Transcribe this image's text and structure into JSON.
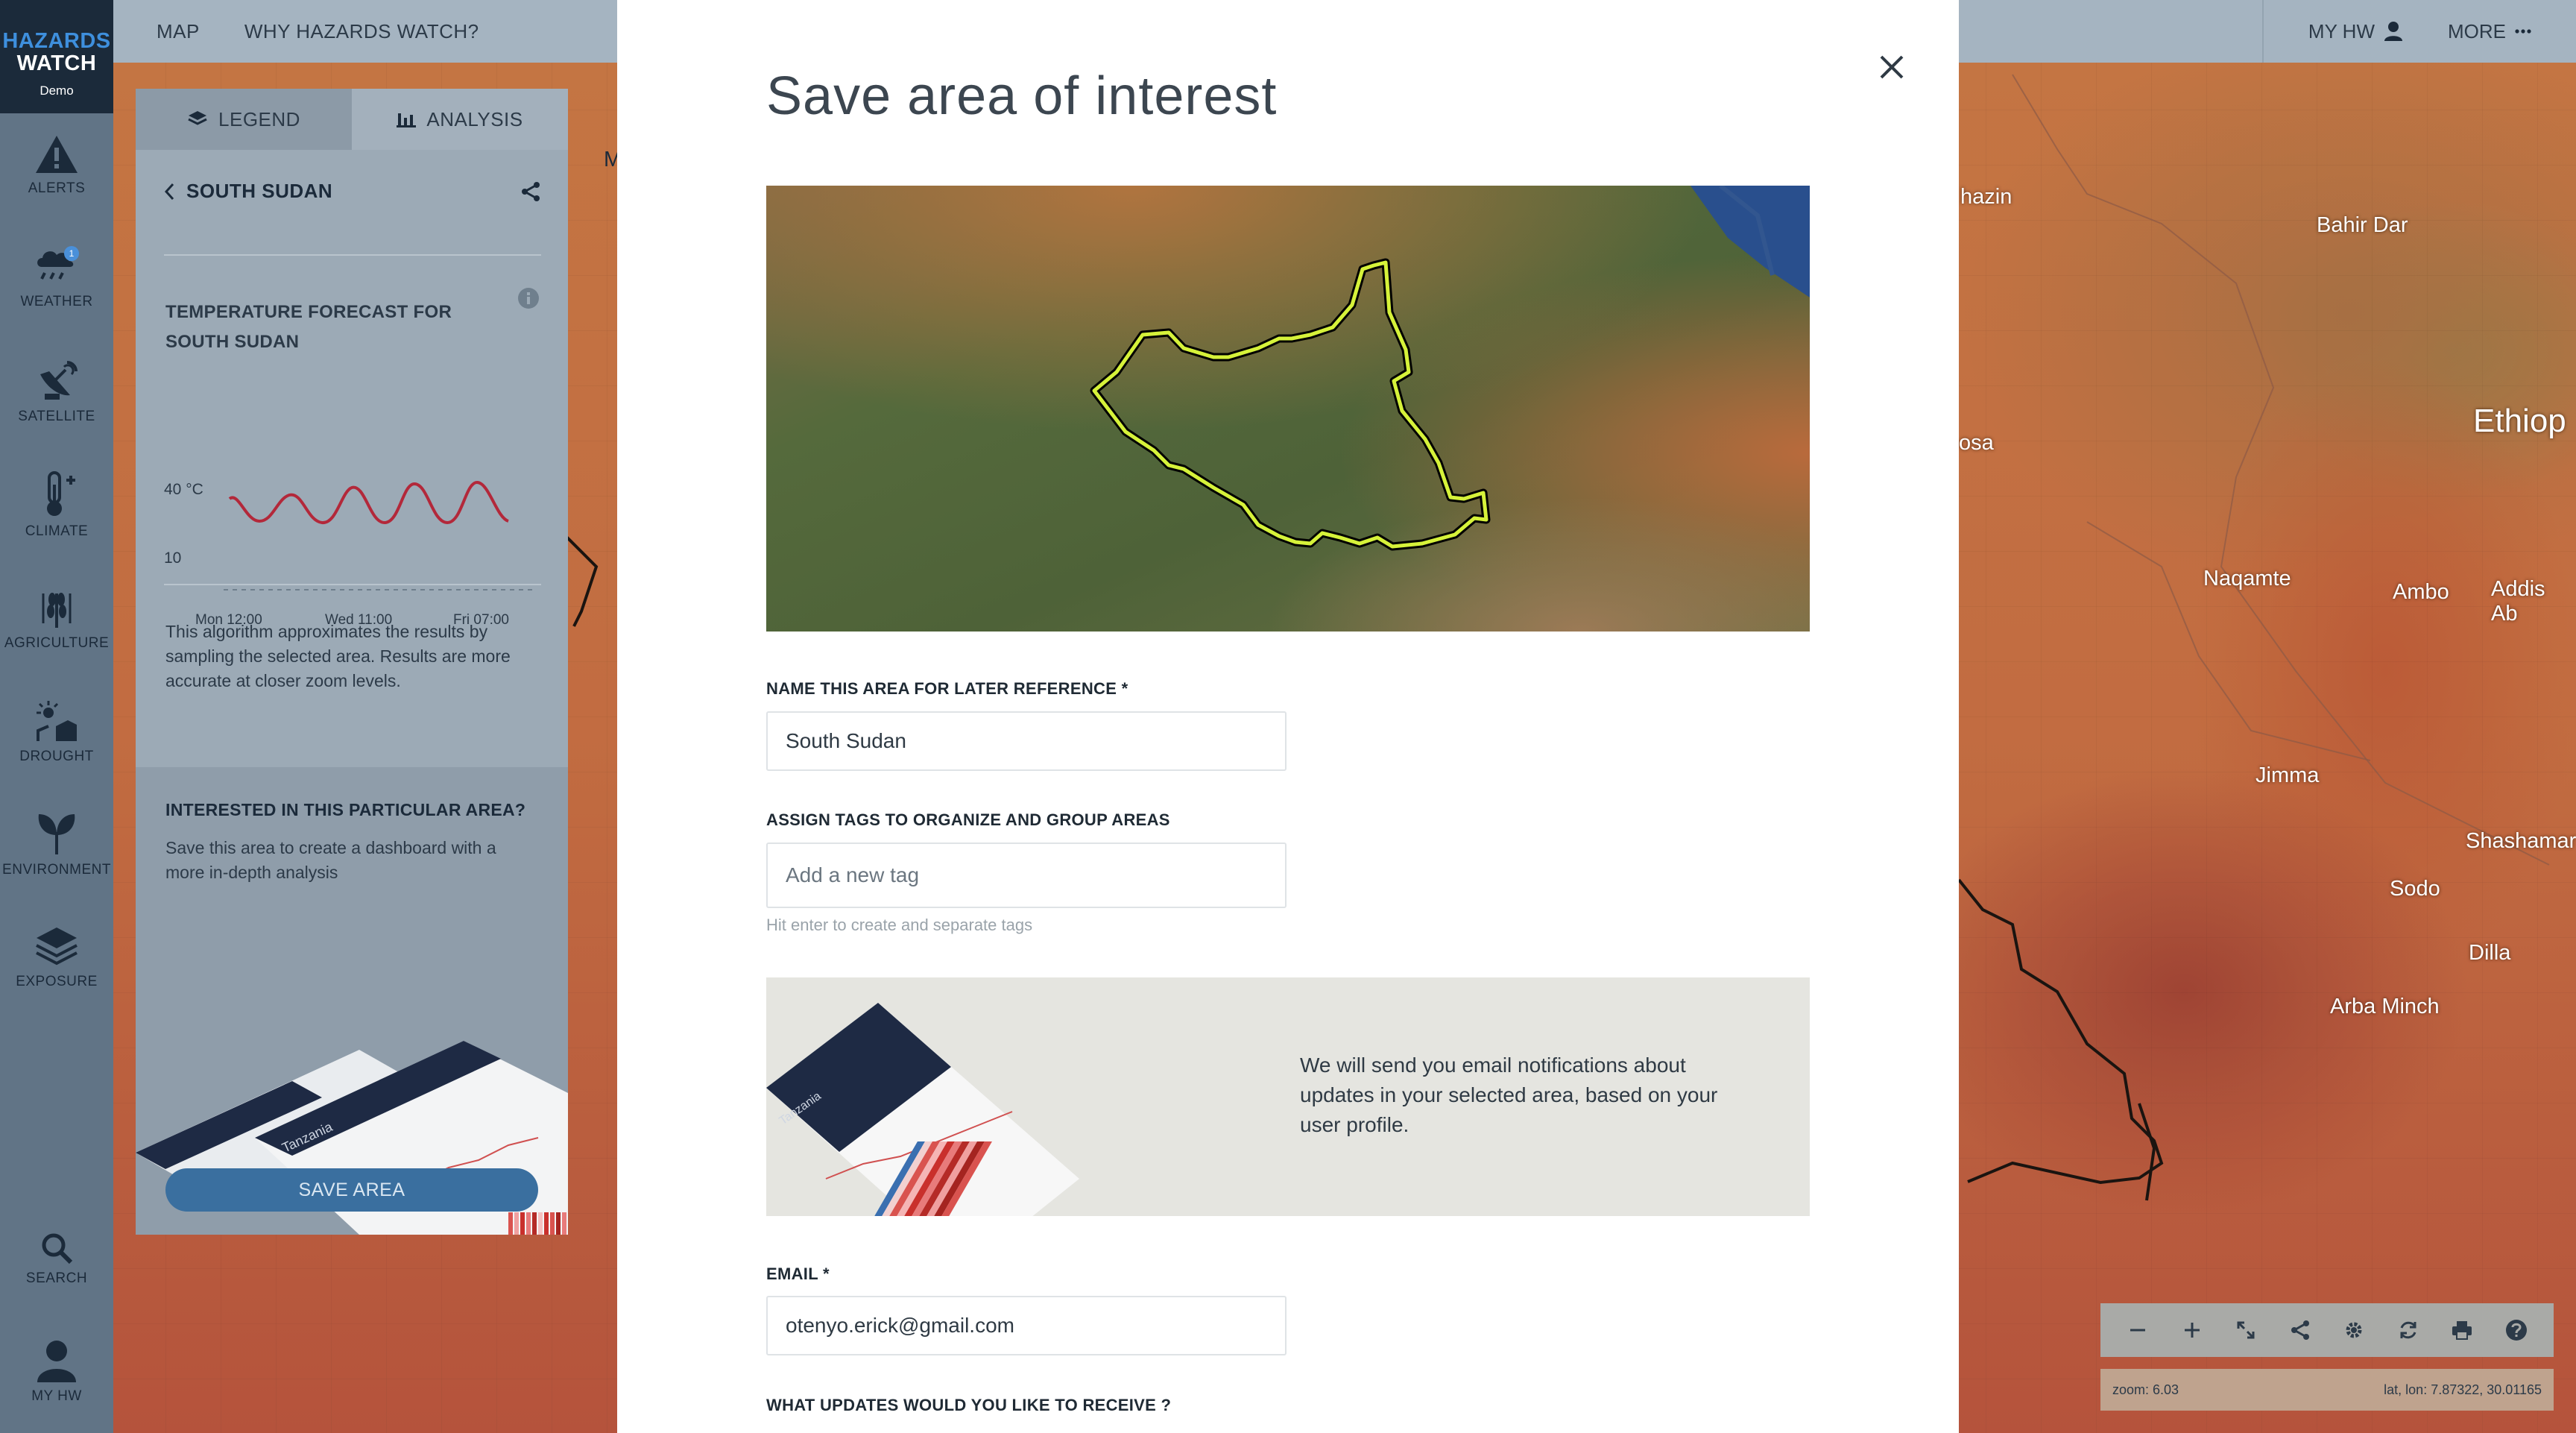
{
  "app": {
    "brand_line1": "HAZARDS",
    "brand_line2": "WATCH",
    "brand_sub": "Demo"
  },
  "topbar": {
    "nav": [
      "MAP",
      "WHY HAZARDS WATCH?"
    ],
    "my_hw": "MY HW",
    "more": "MORE"
  },
  "rail": {
    "items": [
      {
        "label": "ALERTS",
        "icon": "alert-triangle-icon"
      },
      {
        "label": "WEATHER",
        "icon": "weather-rain-icon",
        "badge": "1"
      },
      {
        "label": "SATELLITE",
        "icon": "satellite-dish-icon"
      },
      {
        "label": "CLIMATE",
        "icon": "thermometer-icon"
      },
      {
        "label": "AGRICULTURE",
        "icon": "wheat-icon"
      },
      {
        "label": "DROUGHT",
        "icon": "drought-icon"
      },
      {
        "label": "ENVIRONMENT",
        "icon": "leaf-icon"
      },
      {
        "label": "EXPOSURE",
        "icon": "layers-stack-icon"
      }
    ],
    "bottom": [
      {
        "label": "SEARCH",
        "icon": "search-icon"
      },
      {
        "label": "MY HW",
        "icon": "user-icon"
      }
    ]
  },
  "panel": {
    "tabs": [
      {
        "label": "LEGEND",
        "icon": "layers-icon",
        "active": true
      },
      {
        "label": "ANALYSIS",
        "icon": "bar-chart-icon",
        "active": false
      }
    ],
    "country": "SOUTH SUDAN",
    "forecast_title": "TEMPERATURE FORECAST FOR SOUTH SUDAN",
    "chart_axis_top": "40 °C",
    "chart_axis_bottom": "10",
    "chart_x_labels": [
      "Mon 12:00",
      "Wed 11:00",
      "Fri 07:00"
    ],
    "note": "This algorithm approximates the results by sampling the selected area. Results are more accurate at closer zoom levels.",
    "interest_title": "INTERESTED IN THIS PARTICULAR AREA?",
    "interest_desc": "Save this area to create a dashboard with a more in-depth analysis",
    "preview_label": "Tanzania",
    "save_button": "SAVE AREA",
    "line_color": "#b3283a"
  },
  "modal": {
    "title": "Save area of interest",
    "name_label": "NAME THIS AREA FOR LATER REFERENCE *",
    "name_value": "South Sudan",
    "tags_label": "ASSIGN TAGS TO ORGANIZE AND GROUP AREAS",
    "tags_placeholder": "Add a new tag",
    "tags_hint": "Hit enter to create and separate tags",
    "notify_text": "We will send you email notifications about updates in your selected area, based on your user profile.",
    "notify_preview_label": "Tanzania",
    "email_label": "EMAIL *",
    "email_value": "otenyo.erick@gmail.com",
    "updates_label": "WHAT UPDATES WOULD YOU LIKE TO RECEIVE ?",
    "outline_color": "#d6f23a"
  },
  "map": {
    "places": [
      "hazin",
      "Bahir Dar",
      "Ethiop",
      "osa",
      "Naqamte",
      "Ambo",
      "Addis Ab",
      "Jimma",
      "Shashamar",
      "Sodo",
      "Dilla",
      "Arba Minch",
      "M"
    ],
    "zoom_text": "zoom: 6.03",
    "latlon_text": "lat, lon: 7.87322, 30.01165",
    "controls": [
      "zoom-out-icon",
      "zoom-in-icon",
      "fullscreen-icon",
      "share-icon",
      "settings-icon",
      "refresh-icon",
      "print-icon",
      "help-icon"
    ]
  }
}
